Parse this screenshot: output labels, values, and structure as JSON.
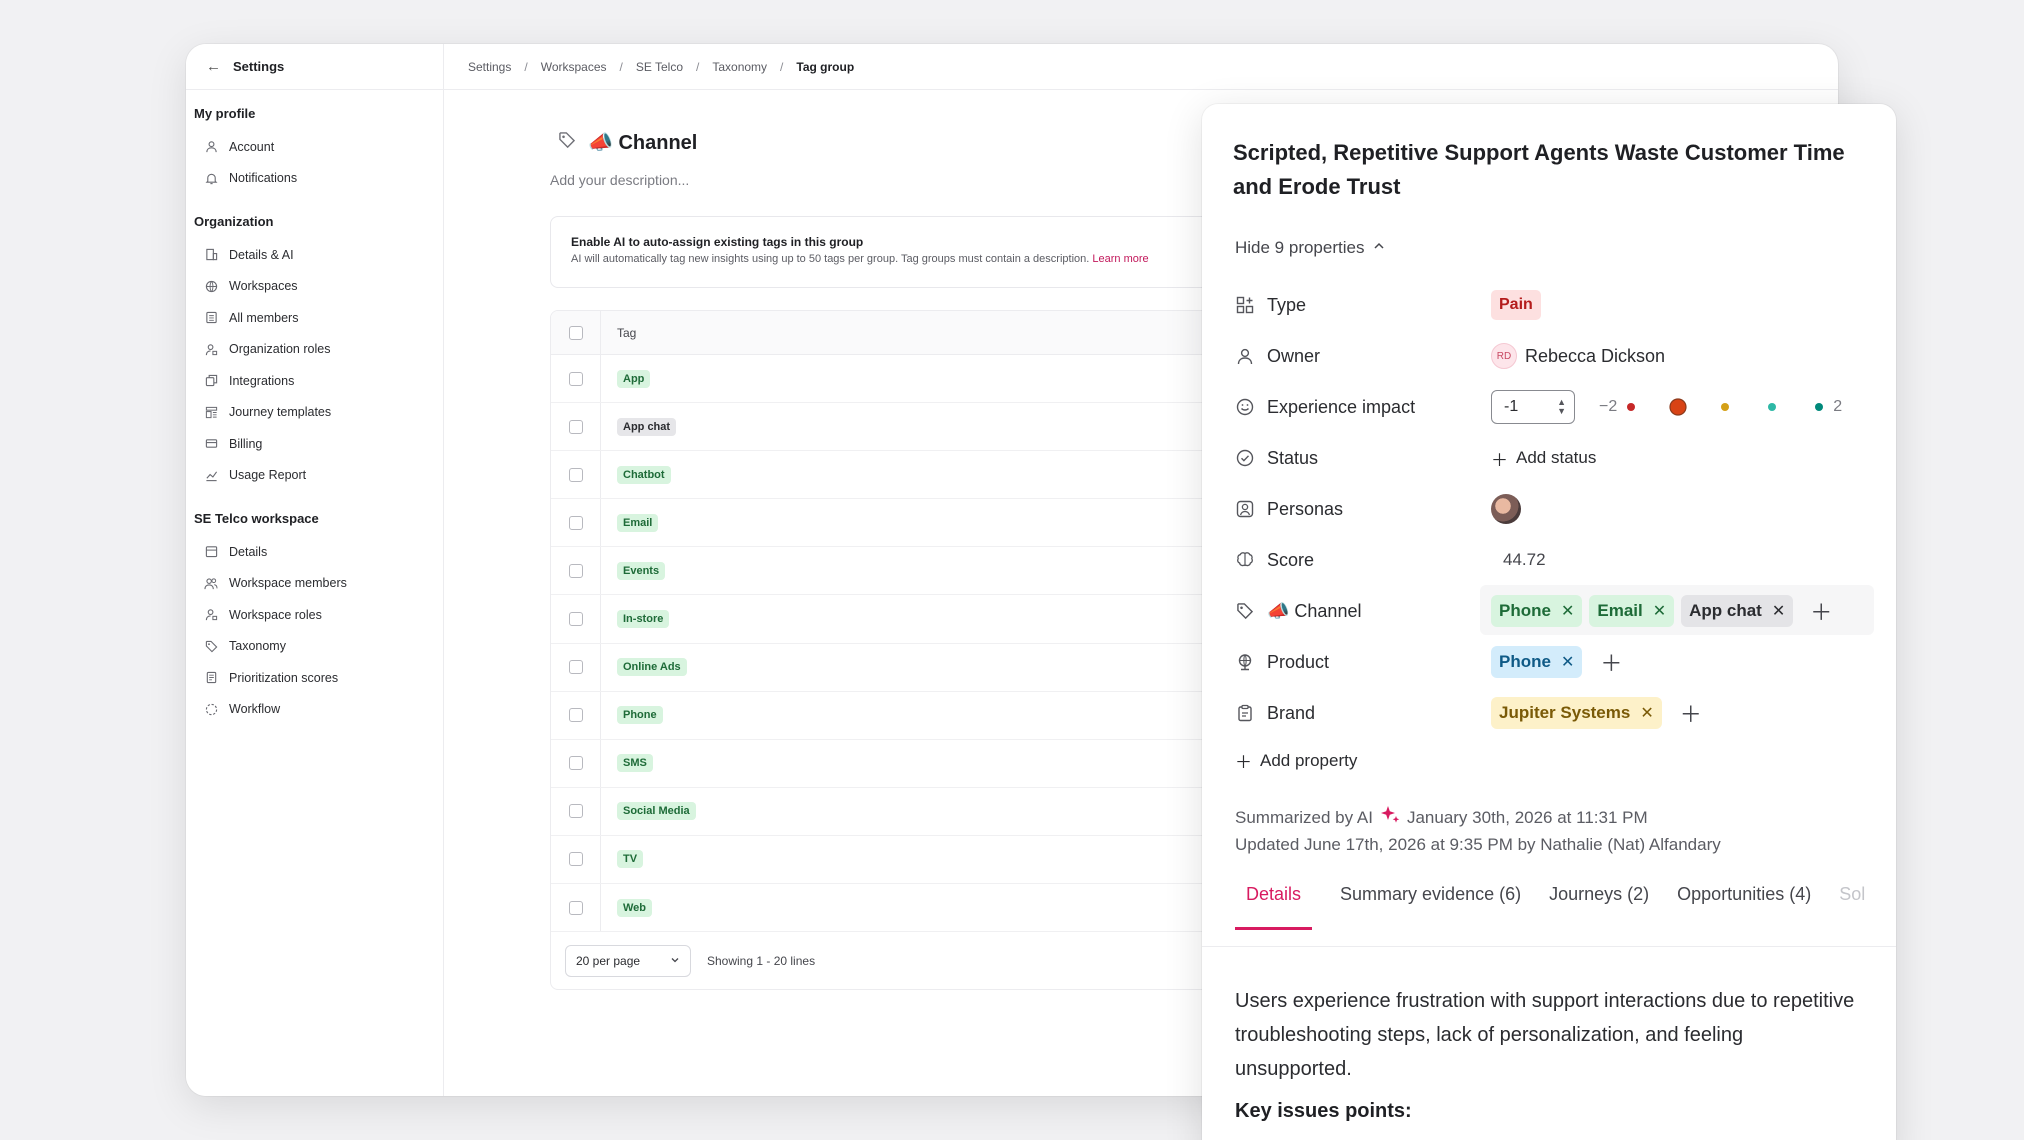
{
  "sidebar": {
    "title": "Settings",
    "sections": [
      {
        "title": "My profile",
        "items": [
          {
            "label": "Account",
            "icon": "user-icon"
          },
          {
            "label": "Notifications",
            "icon": "bell-icon"
          }
        ]
      },
      {
        "title": "Organization",
        "items": [
          {
            "label": "Details & AI",
            "icon": "building-icon"
          },
          {
            "label": "Workspaces",
            "icon": "globe-icon"
          },
          {
            "label": "All members",
            "icon": "list-icon"
          },
          {
            "label": "Organization roles",
            "icon": "user-lock-icon"
          },
          {
            "label": "Integrations",
            "icon": "integrations-icon"
          },
          {
            "label": "Journey templates",
            "icon": "template-icon"
          },
          {
            "label": "Billing",
            "icon": "card-icon"
          },
          {
            "label": "Usage Report",
            "icon": "chart-icon"
          }
        ]
      },
      {
        "title": "SE Telco workspace",
        "items": [
          {
            "label": "Details",
            "icon": "calendar-icon"
          },
          {
            "label": "Workspace members",
            "icon": "users-icon"
          },
          {
            "label": "Workspace roles",
            "icon": "user-lock-icon"
          },
          {
            "label": "Taxonomy",
            "icon": "tags-icon"
          },
          {
            "label": "Prioritization scores",
            "icon": "doc-icon"
          },
          {
            "label": "Workflow",
            "icon": "workflow-icon"
          }
        ]
      }
    ]
  },
  "breadcrumbs": [
    "Settings",
    "Workspaces",
    "SE Telco",
    "Taxonomy",
    "Tag group"
  ],
  "page": {
    "title": "📣 Channel",
    "description_placeholder": "Add your description...",
    "ai_box": {
      "heading": "Enable AI to auto-assign existing tags in this group",
      "text": "AI will automatically tag new insights using up to 50 tags per group. Tag groups must contain a description.",
      "link": "Learn more"
    },
    "table": {
      "header": "Tag",
      "rows": [
        "App",
        "App chat",
        "Chatbot",
        "Email",
        "Events",
        "In-store",
        "Online Ads",
        "Phone",
        "SMS",
        "Social Media",
        "TV",
        "Web"
      ],
      "per_page": "20 per page",
      "showing": "Showing 1 - 20 lines"
    }
  },
  "panel": {
    "title": "Scripted, Repetitive Support Agents Waste Customer Time and Erode Trust",
    "hide_props": "Hide 9 properties",
    "props": {
      "type_label": "Type",
      "type_value": "Pain",
      "owner_label": "Owner",
      "owner_initials": "RD",
      "owner_name": "Rebecca Dickson",
      "impact_label": "Experience impact",
      "impact_value": "-1",
      "impact_min": "−2",
      "impact_max": "2",
      "status_label": "Status",
      "status_add": "Add status",
      "personas_label": "Personas",
      "score_label": "Score",
      "score_value": "44.72",
      "channel_label": "📣 Channel",
      "channel_tags": [
        "Phone",
        "Email",
        "App chat"
      ],
      "product_label": "Product",
      "product_tags": [
        "Phone"
      ],
      "brand_label": "Brand",
      "brand_tags": [
        "Jupiter Systems"
      ]
    },
    "add_property": "Add property",
    "summarized_by": "Summarized by AI",
    "summarized_date": "January 30th, 2026 at 11:31 PM",
    "updated": "Updated June 17th, 2026 at 9:35 PM by Nathalie (Nat) Alfandary",
    "tabs": [
      "Details",
      "Summary evidence (6)",
      "Journeys (2)",
      "Opportunities (4)",
      "Sol"
    ],
    "body": "Users experience frustration with support interactions due to repetitive troubleshooting steps, lack of personalization, and feeling unsupported.",
    "key_issues": "Key issues points:"
  },
  "colors": {
    "accent": "#d81b60",
    "pain_bg": "#fde0e0",
    "tag_green_bg": "#d8f4df"
  }
}
